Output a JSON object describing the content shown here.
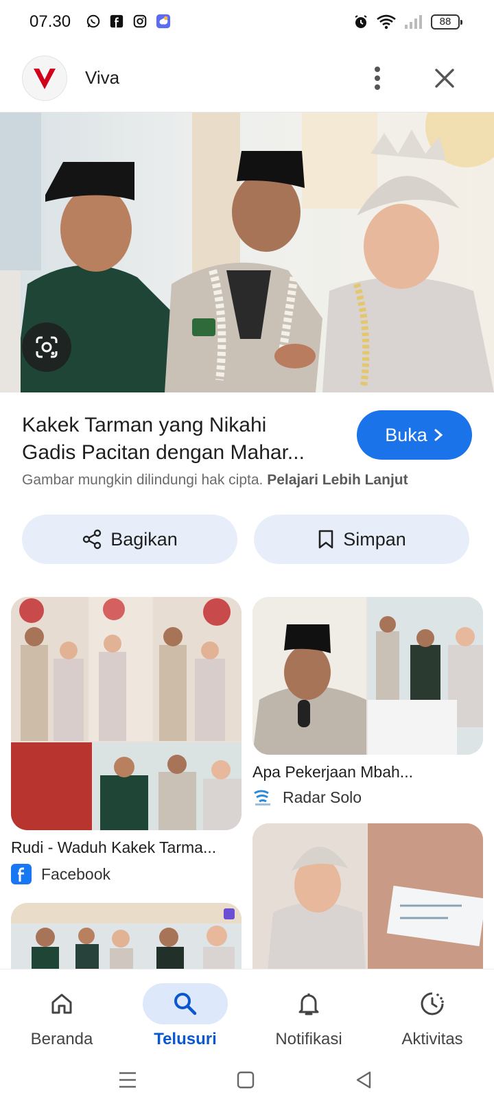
{
  "status_bar": {
    "time": "07.30",
    "battery": "88",
    "app_icons": [
      "whatsapp-icon",
      "facebook-icon",
      "instagram-icon",
      "weather-app-icon"
    ],
    "system_icons": [
      "alarm-icon",
      "wifi-icon",
      "cellular-signal-icon",
      "battery-icon"
    ]
  },
  "header": {
    "source_name": "Viva",
    "logo_letter": "V",
    "brand_color": "#d0021b"
  },
  "detail": {
    "title_line1": "Kakek Tarman yang Nikahi",
    "title_line2": "Gadis Pacitan dengan Mahar...",
    "open_label": "Buka",
    "copyright_text": "Gambar mungkin dilindungi hak cipta.",
    "learn_more": "Pelajari Lebih Lanjut",
    "share_label": "Bagikan",
    "save_label": "Simpan"
  },
  "results": [
    {
      "title": "Rudi - Waduh Kakek Tarma...",
      "source": "Facebook",
      "source_icon": "facebook-icon"
    },
    {
      "title": "Apa Pekerjaan Mbah...",
      "source": "Radar Solo",
      "source_icon": "radar-solo-icon"
    },
    {
      "title": "",
      "source": "",
      "source_icon": ""
    },
    {
      "title": "",
      "source": "",
      "source_icon": ""
    }
  ],
  "bottom_nav": [
    {
      "label": "Beranda",
      "icon": "home-icon",
      "active": false
    },
    {
      "label": "Telusuri",
      "icon": "search-icon",
      "active": true
    },
    {
      "label": "Notifikasi",
      "icon": "bell-icon",
      "active": false
    },
    {
      "label": "Aktivitas",
      "icon": "activity-history-icon",
      "active": false
    }
  ],
  "colors": {
    "accent": "#1a73e8",
    "active_nav": "#0b57d0",
    "chip_bg": "#e7eef9"
  }
}
